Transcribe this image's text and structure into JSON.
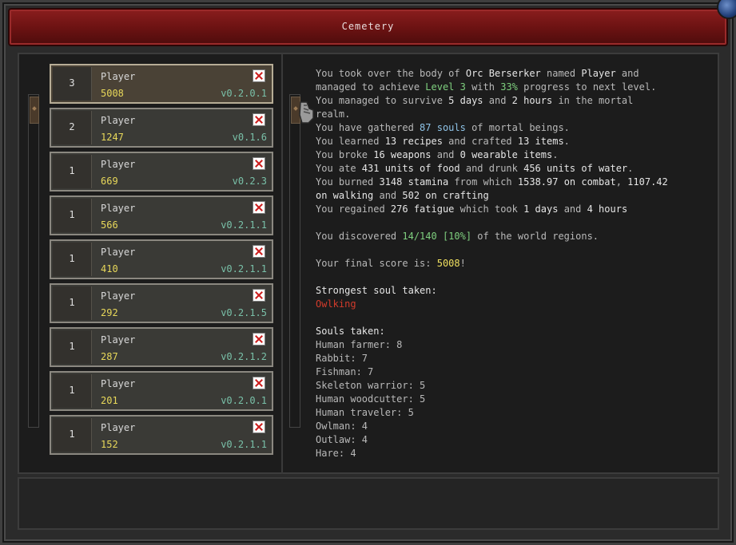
{
  "title": "Cemetery",
  "entries": [
    {
      "rank": "3",
      "name": "Player",
      "score": "5008",
      "version": "v0.2.0.1",
      "selected": true
    },
    {
      "rank": "2",
      "name": "Player",
      "score": "1247",
      "version": "v0.1.6"
    },
    {
      "rank": "1",
      "name": "Player",
      "score": "669",
      "version": "v0.2.3"
    },
    {
      "rank": "1",
      "name": "Player",
      "score": "566",
      "version": "v0.2.1.1"
    },
    {
      "rank": "1",
      "name": "Player",
      "score": "410",
      "version": "v0.2.1.1"
    },
    {
      "rank": "1",
      "name": "Player",
      "score": "292",
      "version": "v0.2.1.5"
    },
    {
      "rank": "1",
      "name": "Player",
      "score": "287",
      "version": "v0.2.1.2"
    },
    {
      "rank": "1",
      "name": "Player",
      "score": "201",
      "version": "v0.2.0.1"
    },
    {
      "rank": "1",
      "name": "Player",
      "score": "152",
      "version": "v0.2.1.1"
    }
  ],
  "story": {
    "l1": [
      [
        "You took over the body of ",
        ""
      ],
      [
        "Orc Berserker",
        "w"
      ],
      [
        " named ",
        ""
      ],
      [
        "Player",
        "w"
      ],
      [
        " and",
        ""
      ]
    ],
    "l2": [
      [
        "managed to achieve ",
        ""
      ],
      [
        "Level 3",
        "g"
      ],
      [
        " with ",
        ""
      ],
      [
        "33%",
        "g"
      ],
      [
        " progress to next level.",
        ""
      ]
    ],
    "l3": [
      [
        "You managed to survive ",
        ""
      ],
      [
        "5 days",
        "w"
      ],
      [
        " and ",
        ""
      ],
      [
        "2 hours",
        "w"
      ],
      [
        " in the mortal",
        ""
      ]
    ],
    "l4": [
      [
        "realm.",
        ""
      ]
    ],
    "l5": [
      [
        "You have gathered ",
        ""
      ],
      [
        "87 souls",
        "c"
      ],
      [
        " of mortal beings.",
        ""
      ]
    ],
    "l6": [
      [
        "You learned ",
        ""
      ],
      [
        "13 recipes",
        "w"
      ],
      [
        " and crafted ",
        ""
      ],
      [
        "13 items",
        "w"
      ],
      [
        ".",
        ""
      ]
    ],
    "l7": [
      [
        "You broke ",
        ""
      ],
      [
        "16 weapons",
        "w"
      ],
      [
        " and ",
        ""
      ],
      [
        "0 wearable items",
        "w"
      ],
      [
        ".",
        ""
      ]
    ],
    "l8": [
      [
        "You ate ",
        ""
      ],
      [
        "431 units of food",
        "w"
      ],
      [
        " and drunk ",
        ""
      ],
      [
        "456 units of water",
        "w"
      ],
      [
        ".",
        ""
      ]
    ],
    "l9": [
      [
        "You burned ",
        ""
      ],
      [
        "3148 stamina",
        "w"
      ],
      [
        " from which ",
        ""
      ],
      [
        "1538.97 on combat",
        "w"
      ],
      [
        ", ",
        ""
      ],
      [
        "1107.42",
        "w"
      ]
    ],
    "l10": [
      [
        "on walking",
        "w"
      ],
      [
        " and ",
        ""
      ],
      [
        "502 on crafting",
        "w"
      ]
    ],
    "l11": [
      [
        "You regained ",
        ""
      ],
      [
        "276 fatigue",
        "w"
      ],
      [
        " which took ",
        ""
      ],
      [
        "1 days",
        "w"
      ],
      [
        " and ",
        ""
      ],
      [
        "4 hours",
        "w"
      ]
    ],
    "l12": [
      [
        "",
        ""
      ]
    ],
    "l13": [
      [
        "You discovered ",
        ""
      ],
      [
        "14/140 [10%]",
        "g"
      ],
      [
        " of the world regions.",
        ""
      ]
    ],
    "l14": [
      [
        "",
        ""
      ]
    ],
    "l15": [
      [
        "Your final score is: ",
        ""
      ],
      [
        "5008",
        "y"
      ],
      [
        "!",
        ""
      ]
    ],
    "l16": [
      [
        "",
        ""
      ]
    ],
    "l17": [
      [
        "Strongest soul taken:",
        "w"
      ]
    ],
    "l18": [
      [
        "Owlking",
        "r"
      ]
    ],
    "l19": [
      [
        "",
        ""
      ]
    ],
    "l20": [
      [
        "Souls taken:",
        "w"
      ]
    ],
    "l21": [
      [
        "Human farmer: 8",
        ""
      ]
    ],
    "l22": [
      [
        "Rabbit: 7",
        ""
      ]
    ],
    "l23": [
      [
        "Fishman: 7",
        ""
      ]
    ],
    "l24": [
      [
        "Skeleton warrior: 5",
        ""
      ]
    ],
    "l25": [
      [
        "Human woodcutter: 5",
        ""
      ]
    ],
    "l26": [
      [
        "Human traveler: 5",
        ""
      ]
    ],
    "l27": [
      [
        "Owlman: 4",
        ""
      ]
    ],
    "l28": [
      [
        "Outlaw: 4",
        ""
      ]
    ],
    "l29": [
      [
        "Hare: 4",
        ""
      ]
    ]
  },
  "colors": {
    "title_bar": "#7a1616",
    "score": "#e8d85a",
    "version": "#79c0a8",
    "highlight_green": "#7fd07f",
    "souls_blue": "#8fc4e8",
    "strongest_red": "#d23b2b"
  }
}
